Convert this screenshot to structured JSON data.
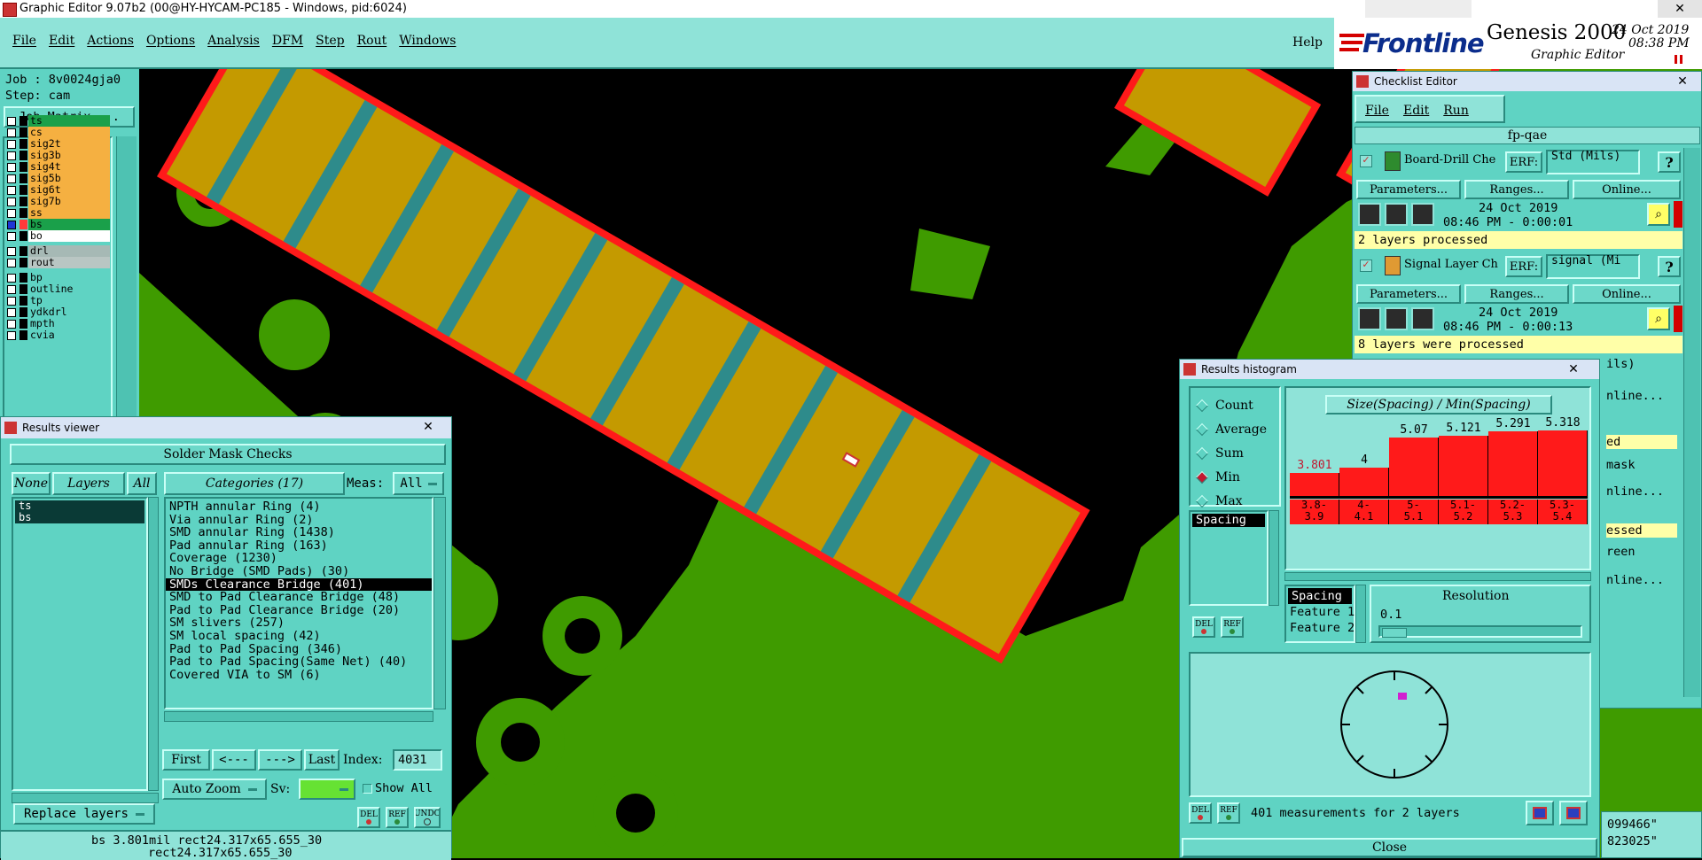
{
  "window": {
    "title": "Graphic Editor 9.07b2 (00@HY-HYCAM-PC185 - Windows, pid:6024)"
  },
  "menu": {
    "items": [
      "File",
      "Edit",
      "Actions",
      "Options",
      "Analysis",
      "DFM",
      "Step",
      "Rout",
      "Windows"
    ],
    "help": "Help"
  },
  "brand": {
    "logo": "Frontline",
    "product": "Genesis 2000",
    "subtitle": "Graphic Editor",
    "date": "24 Oct 2019",
    "time": "08:38 PM"
  },
  "job": {
    "job": "Job : 8v0024gja0",
    "step": "Step: cam",
    "matrix_button": "Job Matrix ..."
  },
  "layers": [
    {
      "name": "ts",
      "color": "#1aa04a",
      "style": "g"
    },
    {
      "name": "cs",
      "color": "#f5b041",
      "style": "o"
    },
    {
      "name": "sig2t",
      "color": "#f5b041",
      "style": "o"
    },
    {
      "name": "sig3b",
      "color": "#f5b041",
      "style": "o"
    },
    {
      "name": "sig4t",
      "color": "#f5b041",
      "style": "o"
    },
    {
      "name": "sig5b",
      "color": "#f5b041",
      "style": "o"
    },
    {
      "name": "sig6t",
      "color": "#f5b041",
      "style": "o"
    },
    {
      "name": "sig7b",
      "color": "#f5b041",
      "style": "o"
    },
    {
      "name": "ss",
      "color": "#f5b041",
      "style": "o"
    },
    {
      "name": "bs",
      "color": "#1aa04a",
      "style": "g"
    },
    {
      "name": "bo",
      "color": "#ffffff",
      "style": "w"
    },
    {
      "name": "drl",
      "color": "#a6b9b5",
      "style": "s"
    },
    {
      "name": "rout",
      "color": "#b9c6c3",
      "style": "s"
    },
    {
      "name": "bp",
      "color": "#5fd3c3",
      "style": "t"
    },
    {
      "name": "outline",
      "color": "#5fd3c3",
      "style": "t"
    },
    {
      "name": "tp",
      "color": "#5fd3c3",
      "style": "t"
    },
    {
      "name": "ydkdrl",
      "color": "#5fd3c3",
      "style": "t"
    },
    {
      "name": "mpth",
      "color": "#5fd3c3",
      "style": "t"
    },
    {
      "name": "cvia",
      "color": "#5fd3c3",
      "style": "t"
    }
  ],
  "results_viewer": {
    "title": "Results viewer",
    "heading": "Solder Mask Checks",
    "none_btn": "None",
    "layers_btn": "Layers",
    "all_btn": "All",
    "categories_label": "Categories (17)",
    "meas_label": "Meas:",
    "meas_value": "All",
    "layer_list": [
      "ts",
      "bs"
    ],
    "categories": [
      "NPTH annular Ring (4)",
      "Via annular Ring (2)",
      "SMD annular Ring (1438)",
      "Pad annular Ring (163)",
      "Coverage (1230)",
      "No Bridge (SMD Pads) (30)",
      "SMDs Clearance Bridge (401)",
      "SMD to Pad Clearance Bridge (48)",
      "Pad to Pad Clearance Bridge (20)",
      "SM slivers (257)",
      "SM local spacing (42)",
      "Pad to Pad Spacing (346)",
      "Pad to Pad Spacing(Same Net) (40)",
      "Covered VIA to SM (6)"
    ],
    "selected_index": 6,
    "nav": {
      "first": "First",
      "prev": "<---",
      "next": "--->",
      "last": "Last",
      "index_label": "Index:",
      "index_value": "4031"
    },
    "auto_zoom": "Auto Zoom",
    "sv_label": "Sv:",
    "show_all": "Show All",
    "replace_layers": "Replace layers",
    "del": "DEL",
    "ref": "REF",
    "undo": "UNDO",
    "status1": "bs 3.801mil  rect24.317x65.655_30",
    "status2": "rect24.317x65.655_30"
  },
  "checklist": {
    "title": "Checklist Editor",
    "menu": [
      "File",
      "Edit",
      "Run"
    ],
    "name": "fp-qae",
    "items": [
      {
        "label": "Board-Drill Che",
        "erf": "ERF:",
        "erf_value": "Std (Mils)",
        "date": "24 Oct 2019",
        "time": "08:46 PM - 0:00:01",
        "status": "2 layers processed"
      },
      {
        "label": "Signal Layer Ch",
        "erf": "ERF:",
        "erf_value": "signal (Mi",
        "date": "24 Oct 2019",
        "time": "08:46 PM - 0:00:13",
        "status": "8 layers were processed"
      }
    ],
    "params": "Parameters...",
    "ranges": "Ranges...",
    "online": "Online...",
    "hidden_fragments": [
      "ils)",
      "nline...",
      "ed",
      "mask",
      "nline...",
      "essed",
      "reen",
      "nline..."
    ]
  },
  "histogram": {
    "title": "Results histogram",
    "modes": [
      "Count",
      "Average",
      "Sum",
      "Min",
      "Max"
    ],
    "selected_mode": "Min",
    "measure_list": [
      "Spacing"
    ],
    "chart_title": "Size(Spacing) / Min(Spacing)",
    "chart_data": {
      "type": "bar",
      "title": "Size(Spacing) / Min(Spacing)",
      "categories": [
        "3.8-3.9",
        "4-4.1",
        "5-5.1",
        "5.1-5.2",
        "5.2-5.3",
        "5.3-5.4"
      ],
      "bin_labels": [
        [
          "3.8-",
          "3.9"
        ],
        [
          "4-",
          "4.1"
        ],
        [
          "5-",
          "5.1"
        ],
        [
          "5.1-",
          "5.2"
        ],
        [
          "5.2-",
          "5.3"
        ],
        [
          "5.3-",
          "5.4"
        ]
      ],
      "values": [
        3.801,
        4,
        5.07,
        5.121,
        5.291,
        5.318
      ],
      "value_labels": [
        "3.801",
        "4",
        "5.07",
        "5.121",
        "5.291",
        "5.318"
      ],
      "ylim": [
        0,
        5.5
      ]
    },
    "sort_list": [
      "Spacing",
      "Feature 1",
      "Feature 2"
    ],
    "resolution_label": "Resolution",
    "resolution_value": "0.1",
    "summary": "401 measurements for 2 layers",
    "close": "Close",
    "del": "DEL",
    "ref": "REF"
  },
  "coords": {
    "x": "099466\"",
    "y": "823025\""
  }
}
